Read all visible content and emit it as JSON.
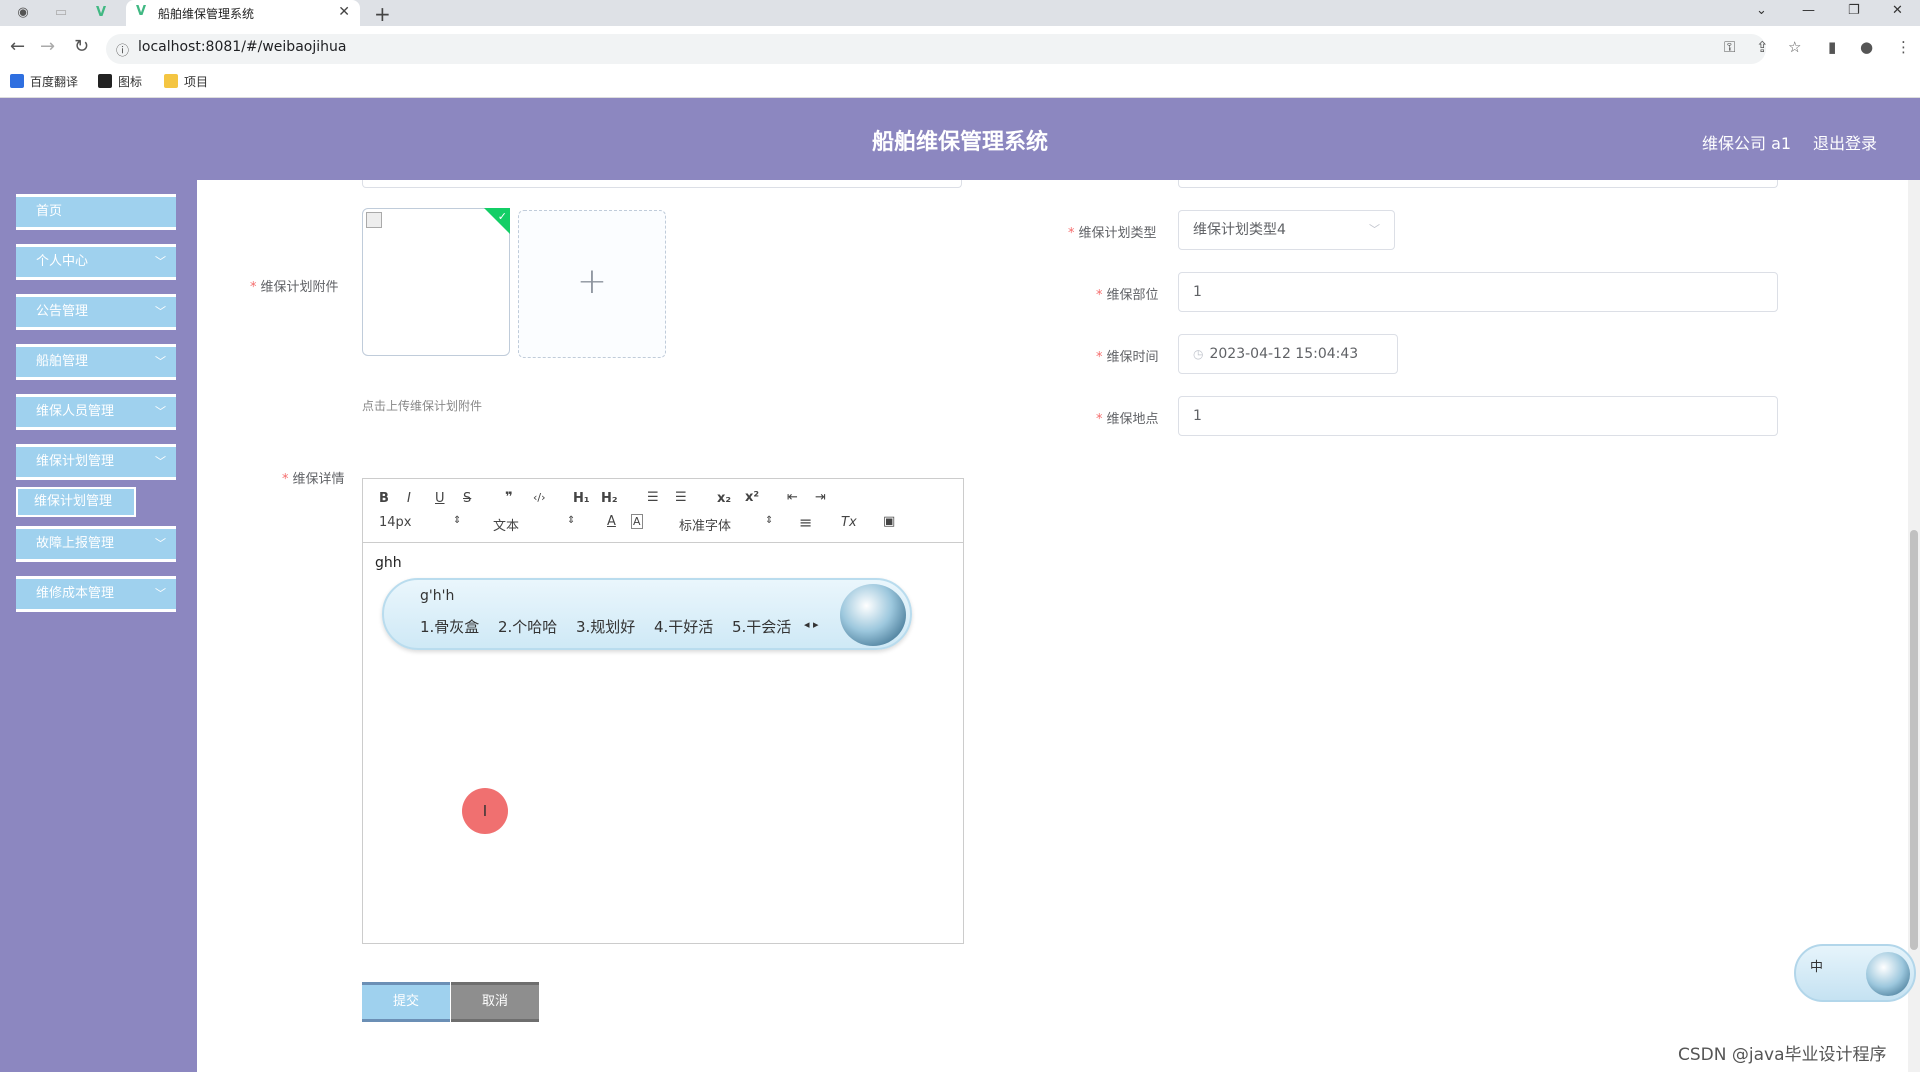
{
  "browser": {
    "tab_title": "船舶维保管理系统",
    "url": "localhost:8081/#/weibaojihua",
    "bookmarks": [
      "百度翻译",
      "图标",
      "项目"
    ]
  },
  "header": {
    "title": "船舶维保管理系统",
    "user": "维保公司 a1",
    "logout": "退出登录"
  },
  "sidebar": {
    "items": [
      {
        "label": "首页",
        "expandable": false
      },
      {
        "label": "个人中心",
        "expandable": true
      },
      {
        "label": "公告管理",
        "expandable": true
      },
      {
        "label": "船舶管理",
        "expandable": true
      },
      {
        "label": "维保人员管理",
        "expandable": true
      },
      {
        "label": "维保计划管理",
        "expandable": true
      },
      {
        "label": "故障上报管理",
        "expandable": true
      },
      {
        "label": "维修成本管理",
        "expandable": true
      }
    ],
    "submenu": {
      "label": "维保计划管理"
    }
  },
  "form": {
    "attachment_label": "维保计划附件",
    "attachment_tip": "点击上传维保计划附件",
    "plan_type_label": "维保计划类型",
    "plan_type_value": "维保计划类型4",
    "part_label": "维保部位",
    "part_value": "1",
    "time_label": "维保时间",
    "time_value": "2023-04-12 15:04:43",
    "location_label": "维保地点",
    "location_value": "1",
    "detail_label": "维保详情"
  },
  "editor": {
    "toolbar": {
      "bold": "B",
      "italic": "I",
      "underline": "U",
      "strike": "S",
      "quote": "❞",
      "code": "‹/›",
      "h1": "H₁",
      "h2": "H₂",
      "ol": "☰",
      "ul": "☰",
      "sub": "x₂",
      "sup": "x²",
      "indent_out": "⇤",
      "indent_in": "⇥",
      "size": "14px",
      "format": "文本",
      "color": "A",
      "bg": "A",
      "font": "标准字体",
      "align": "≡",
      "clean": "Tx",
      "image": "▣"
    },
    "content": "ghh"
  },
  "ime": {
    "composition": "g'h'h",
    "candidates": [
      "1.骨灰盒",
      "2.个哈哈",
      "3.规划好",
      "4.干好活",
      "5.干会活"
    ],
    "float_label": "中"
  },
  "buttons": {
    "submit": "提交",
    "cancel": "取消"
  },
  "watermark": "CSDN @java毕业设计程序"
}
